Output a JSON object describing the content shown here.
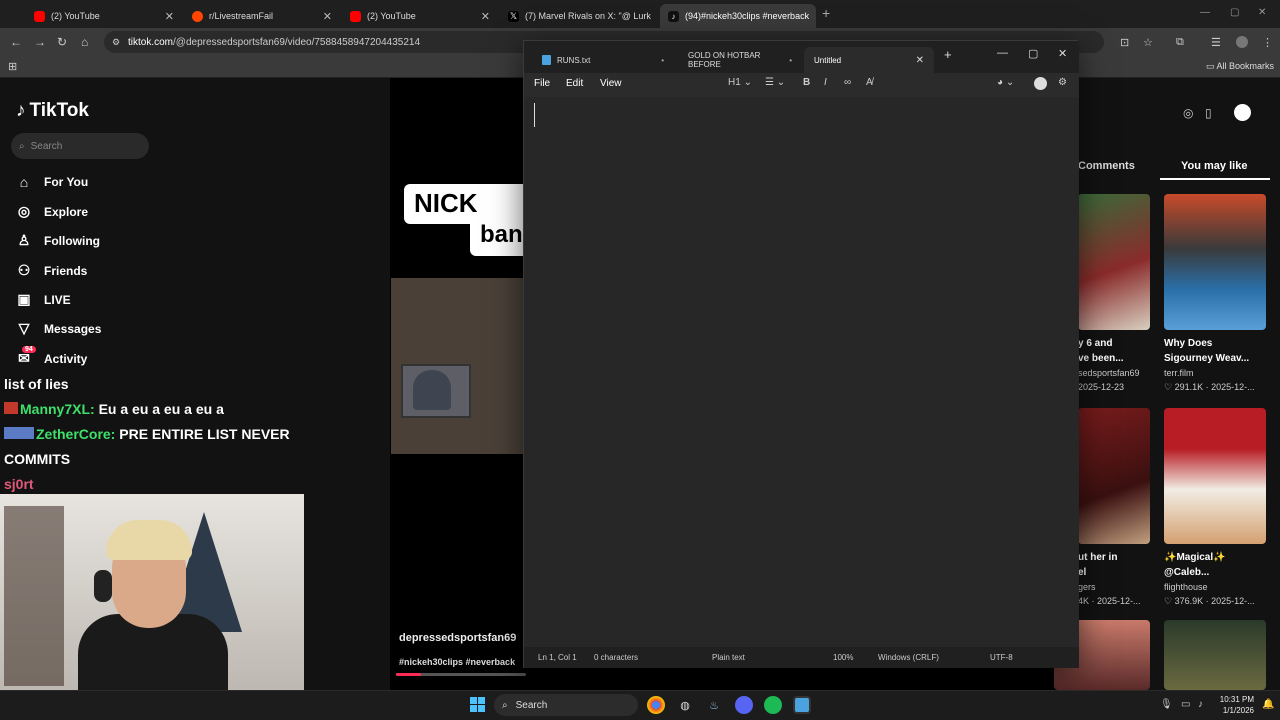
{
  "browser": {
    "tabs": [
      {
        "label": "(2) YouTube",
        "color": "#ff0000"
      },
      {
        "label": "r/LivestreamFail",
        "color": "#ff4500"
      },
      {
        "label": "(2) YouTube",
        "color": "#ff0000"
      },
      {
        "label": "(7) Marvel Rivals on X: \"@ Lurk",
        "color": "#ffffff"
      },
      {
        "label": "(94)#nickeh30clips #neverback",
        "color": "#000000"
      }
    ],
    "url_host": "tiktok.com",
    "url_path": "/@depressedsportsfan69/video/7588458947204435214",
    "all_bookmarks": "All Bookmarks"
  },
  "tiktok": {
    "logo": "TikTok",
    "search_placeholder": "Search",
    "nav": [
      {
        "label": "For You",
        "icon": "home-icon"
      },
      {
        "label": "Explore",
        "icon": "compass-icon"
      },
      {
        "label": "Following",
        "icon": "following-icon"
      },
      {
        "label": "Friends",
        "icon": "friends-icon"
      },
      {
        "label": "LIVE",
        "icon": "live-icon"
      },
      {
        "label": "Messages",
        "icon": "messages-icon"
      },
      {
        "label": "Activity",
        "icon": "activity-icon"
      }
    ],
    "activity_badge": "94",
    "video": {
      "caption_line1": "NICK EH",
      "caption_line2": "ban",
      "author": "depressedsportsfan69",
      "tags": "#nickeh30clips #neverback",
      "progress": 0.19
    },
    "right_panel": {
      "tab_comments": "Comments",
      "tab_you_may_like": "You may like",
      "cards": [
        {
          "title": "y 6 and",
          "title2": "ve been...",
          "meta": "sedsportsfan69",
          "meta2": "2025-12-23",
          "colors": [
            "#8a2b2b",
            "#d8d0c0"
          ]
        },
        {
          "title": "Why Does",
          "title2": "Sigourney Weav...",
          "meta": "terr.film",
          "meta2": "♡ 291.1K · 2025-12-...",
          "colors": [
            "#2a6fa8",
            "#c84a2a"
          ]
        },
        {
          "title": "ut her in",
          "title2": "el",
          "meta": "gers",
          "meta2": "4K · 2025-12-...",
          "colors": [
            "#7a1c1c",
            "#3a1010"
          ]
        },
        {
          "title": "✨Magical✨",
          "title2": "@Caleb...",
          "meta": "flighthouse",
          "meta2": "♡ 376.9K · 2025-12-...",
          "colors": [
            "#b81c24",
            "#f1ede4"
          ]
        }
      ]
    }
  },
  "stream_overlay": {
    "chat": [
      {
        "user": "",
        "text": "list of lies"
      },
      {
        "user": "Manny7XL:",
        "text": "Eu a eu a eu a eu a"
      },
      {
        "user": "ZetherCore:",
        "text": "PRE ENTIRE LIST NEVER"
      },
      {
        "user": "",
        "text": "COMMITS"
      },
      {
        "user": "sj0rt",
        "text": ""
      }
    ]
  },
  "notepad": {
    "tabs": [
      {
        "label": "RUNS.txt",
        "modified": "•"
      },
      {
        "label": "GOLD ON HOTBAR BEFORE",
        "modified": "•"
      },
      {
        "label": "Untitled",
        "modified": ""
      }
    ],
    "menu": [
      "File",
      "Edit",
      "View"
    ],
    "heading": "H1",
    "status": {
      "position": "Ln 1, Col 1",
      "chars": "0 characters",
      "format": "Plain text",
      "zoom": "100%",
      "line_ending": "Windows (CRLF)",
      "encoding": "UTF-8"
    }
  },
  "taskbar": {
    "search": "Search",
    "time": "10:31 PM",
    "date": "1/1/2026"
  }
}
